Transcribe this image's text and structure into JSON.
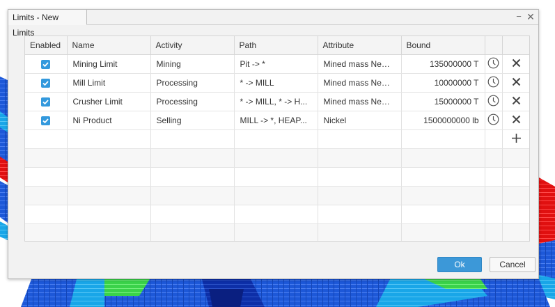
{
  "dialog": {
    "title": "Limits - New Limits",
    "min_glyph": "−",
    "close_glyph": "✕"
  },
  "columns": [
    "Enabled",
    "Name",
    "Activity",
    "Path",
    "Attribute",
    "Bound",
    "",
    ""
  ],
  "rows": [
    {
      "enabled": true,
      "name": "Mining Limit",
      "activity": "Mining",
      "path": "Pit -> *",
      "attribute": "Mined mass New ...",
      "bound": "135000000 T"
    },
    {
      "enabled": true,
      "name": "Mill Limit",
      "activity": "Processing",
      "path": "* -> MILL",
      "attribute": "Mined mass New ...",
      "bound": "10000000 T"
    },
    {
      "enabled": true,
      "name": "Crusher Limit",
      "activity": "Processing",
      "path": "* -> MILL, * -> H...",
      "attribute": "Mined mass New ...",
      "bound": "15000000 T"
    },
    {
      "enabled": true,
      "name": "Ni Product",
      "activity": "Selling",
      "path": "MILL -> *, HEAP...",
      "attribute": "Nickel",
      "bound": "1500000000 lb"
    }
  ],
  "row_icons": {
    "schedule": "clock-icon",
    "remove": "close-icon",
    "add": "plus-icon"
  },
  "buttons": {
    "ok": "Ok",
    "cancel": "Cancel"
  },
  "colors": {
    "accent": "#3399dd",
    "ok_button": "#3c98d8"
  }
}
